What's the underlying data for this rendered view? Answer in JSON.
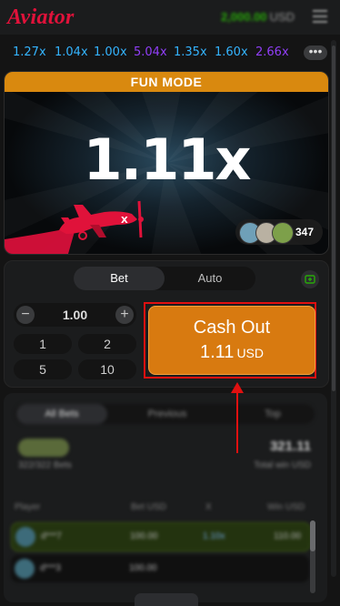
{
  "header": {
    "logo": "Aviator",
    "balance_amount": "2,000.00",
    "balance_currency": "USD"
  },
  "history": [
    {
      "value": "1.27x",
      "color": "#34b4ff"
    },
    {
      "value": "1.04x",
      "color": "#34b4ff"
    },
    {
      "value": "1.00x",
      "color": "#34b4ff"
    },
    {
      "value": "5.04x",
      "color": "#913ef8"
    },
    {
      "value": "1.35x",
      "color": "#34b4ff"
    },
    {
      "value": "1.60x",
      "color": "#34b4ff"
    },
    {
      "value": "2.66x",
      "color": "#913ef8"
    }
  ],
  "history_more": "•••",
  "game": {
    "mode_banner": "FUN MODE",
    "multiplier": "1.11x",
    "players_count": "347"
  },
  "bet_panel": {
    "tabs": [
      "Bet",
      "Auto"
    ],
    "stake": "1.00",
    "minus": "−",
    "plus": "+",
    "quick_values": [
      "1",
      "2",
      "5",
      "10"
    ],
    "cashout_label": "Cash Out",
    "cashout_amount": "1.11",
    "cashout_currency": "USD"
  },
  "bets_list": {
    "tabs": [
      "All Bets",
      "Previous",
      "Top"
    ],
    "total_value": "321.11",
    "total_label": "322/322 Bets",
    "total_win": "Total win USD",
    "columns": [
      "Player",
      "Bet USD",
      "X",
      "Win USD"
    ],
    "rows": [
      {
        "player": "d***7",
        "bet": "100.00",
        "x": "1.10x",
        "win": "110.00"
      },
      {
        "player": "d***3",
        "bet": "100.00",
        "x": "",
        "win": ""
      }
    ]
  },
  "colors": {
    "accent_red": "#e0123a",
    "banner_orange": "#d9890f",
    "cashout_orange": "#d87a10",
    "balance_green": "#28a909",
    "annotation_red": "#e01010"
  }
}
